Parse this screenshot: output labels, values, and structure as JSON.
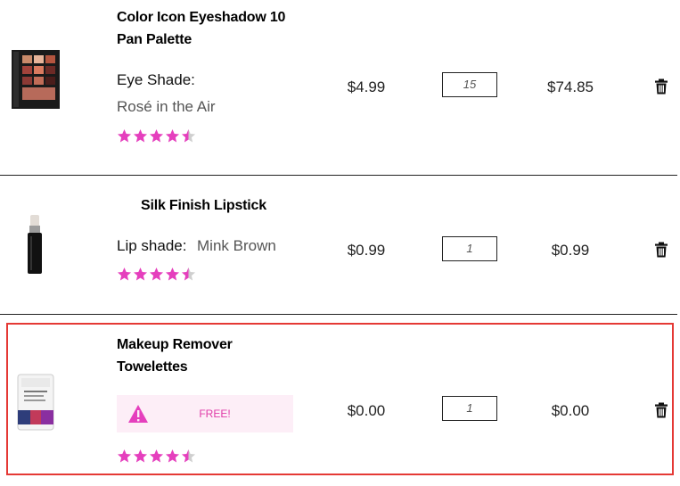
{
  "colors": {
    "star": "#e53fbd",
    "star_empty": "#cfcfcf",
    "highlight": "#e53935",
    "promo_bg": "#fdeef7",
    "warn": "#e53fbd"
  },
  "items": [
    {
      "title_line1": "Color Icon Eyeshadow 10",
      "title_line2": "Pan Palette",
      "attr_label": "Eye Shade:",
      "attr_value": "Rosé in the Air",
      "price": "$4.99",
      "qty": "15",
      "total": "$74.85",
      "rating": 4.5,
      "image_icon": "eyeshadow-palette-icon"
    },
    {
      "title_line1": "Silk Finish Lipstick",
      "attr_label": "Lip shade:",
      "attr_value": "Mink Brown",
      "price": "$0.99",
      "qty": "1",
      "total": "$0.99",
      "rating": 4.5,
      "image_icon": "lipstick-icon"
    },
    {
      "title_line1": "Makeup Remover",
      "title_line2": "Towelettes",
      "promo_text": "FREE!",
      "price": "$0.00",
      "qty": "1",
      "total": "$0.00",
      "rating": 4.5,
      "image_icon": "towelettes-pack-icon"
    }
  ]
}
